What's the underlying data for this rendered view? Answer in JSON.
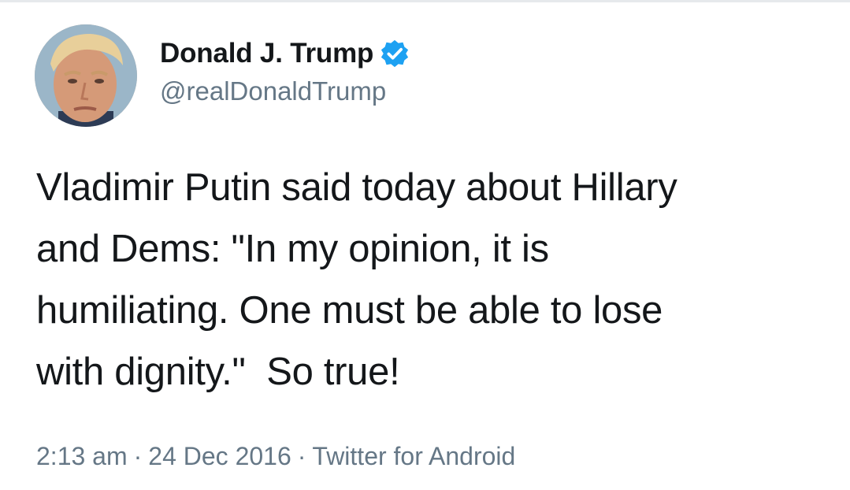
{
  "tweet": {
    "display_name": "Donald J. Trump",
    "handle": "@realDonaldTrump",
    "verified": true,
    "text": "Vladimir Putin said today about Hillary\nand Dems: \"In my opinion, it is\nhumiliating. One must be able to lose\nwith dignity.\"  So true!",
    "time": "2:13 am",
    "separator": "·",
    "date": "24 Dec 2016",
    "source": "Twitter for Android"
  },
  "icons": {
    "avatar": "profile-photo",
    "verified": "verified-badge-icon"
  },
  "colors": {
    "name": "#14171a",
    "secondary": "#657786",
    "verified_blue": "#1da1f2",
    "background": "#ffffff"
  }
}
